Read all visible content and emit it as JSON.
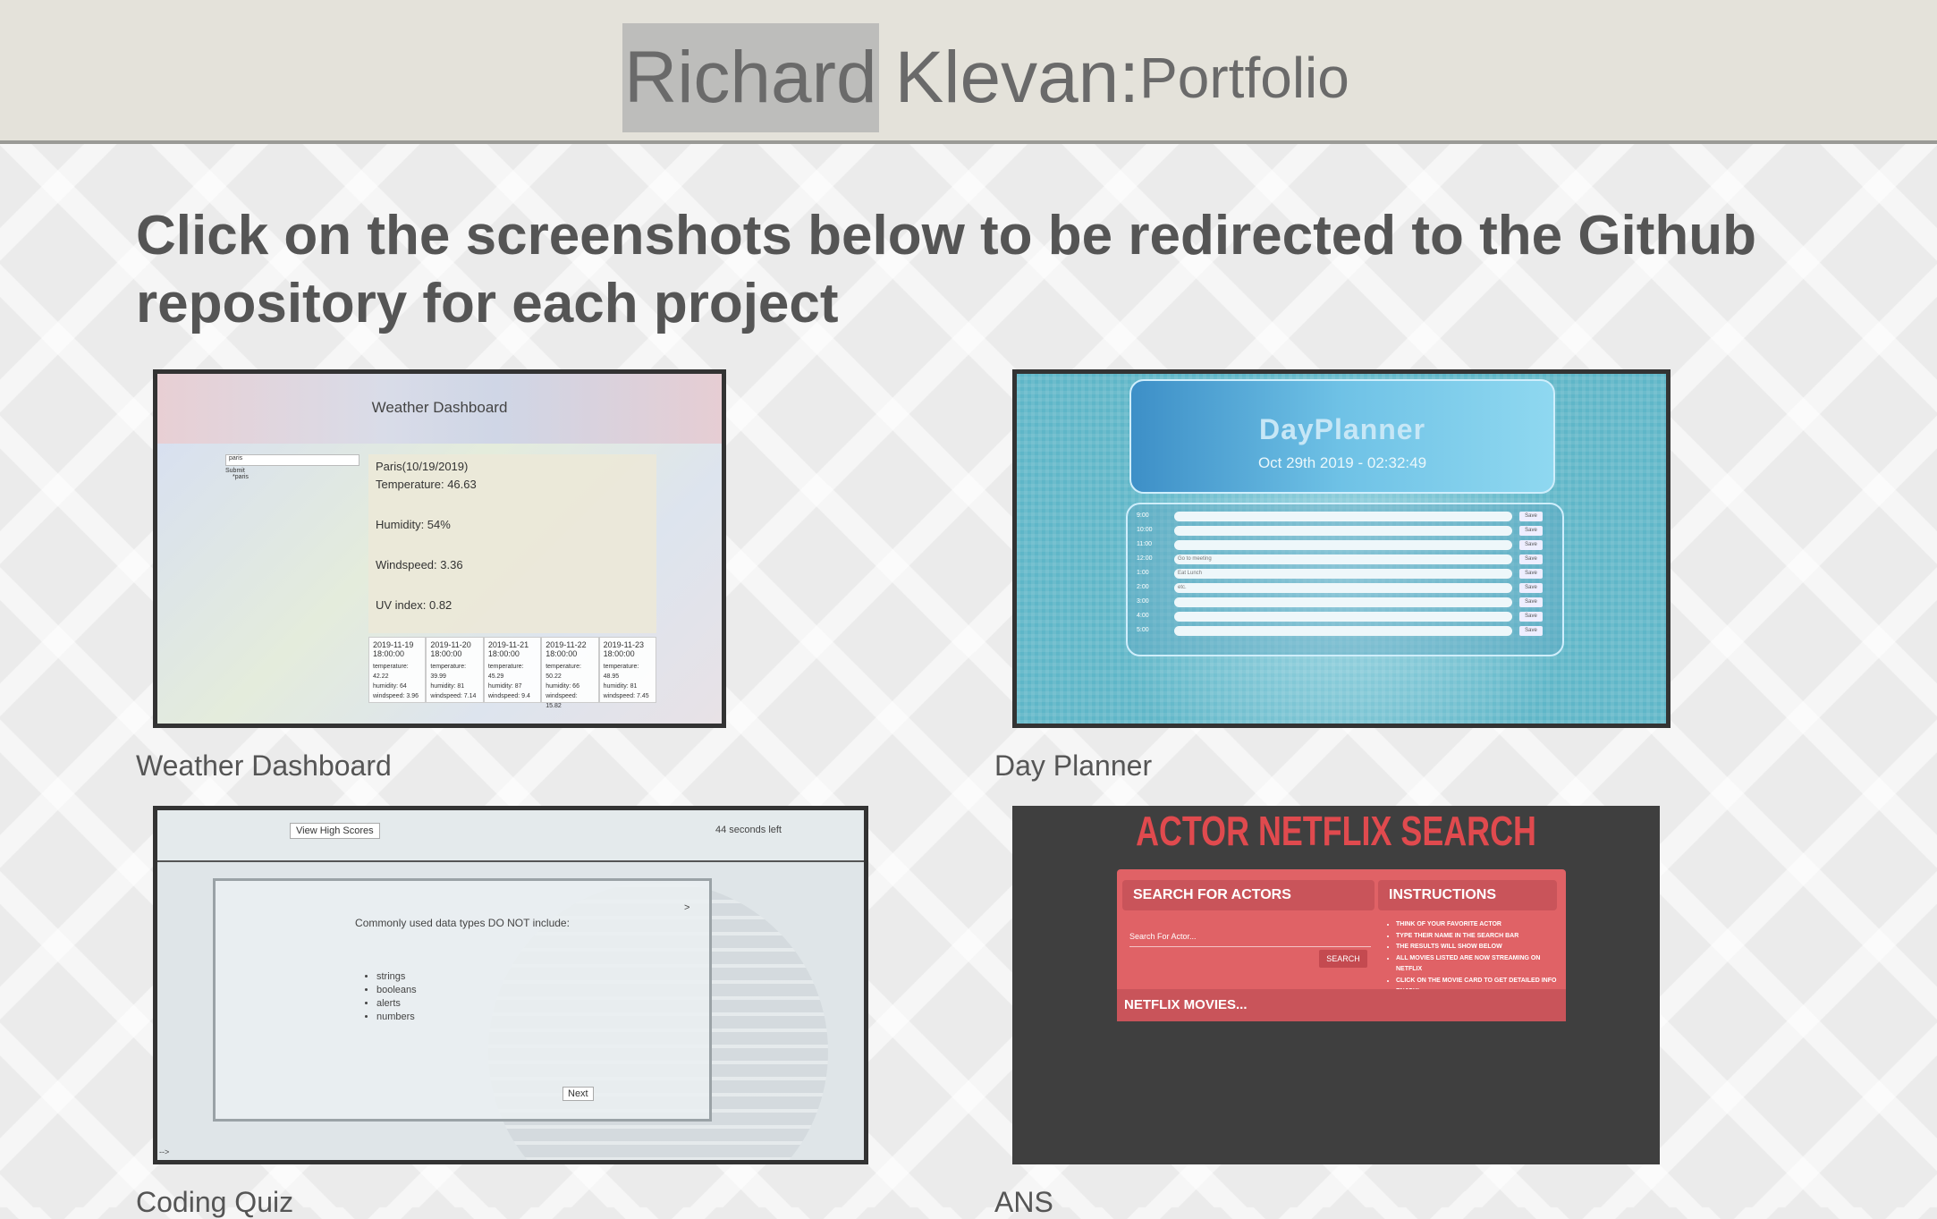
{
  "header": {
    "brand_first": "Richard",
    "brand_last": "Klevan:",
    "brand_sub": "Portfolio"
  },
  "intro": "Click on the screenshots below to be redirected to the Github repository for each project",
  "projects": [
    {
      "caption": "Weather Dashboard",
      "preview": {
        "title": "Weather Dashboard",
        "search_value": "paris",
        "submit_label": "Submit",
        "history_item": "*paris",
        "city_date": "Paris(10/19/2019)",
        "temperature": "Temperature: 46.63",
        "humidity": "Humidity: 54%",
        "windspeed": "Windspeed: 3.36",
        "uv": "UV index: 0.82",
        "forecast": [
          {
            "date": "2019-11-19 18:00:00",
            "temp": "temperature: 42.22",
            "hum": "humidity: 64",
            "wind": "windspeed: 3.96"
          },
          {
            "date": "2019-11-20 18:00:00",
            "temp": "temperature: 39.99",
            "hum": "humidity: 81",
            "wind": "windspeed: 7.14"
          },
          {
            "date": "2019-11-21 18:00:00",
            "temp": "temperature: 45.29",
            "hum": "humidity: 87",
            "wind": "windspeed: 9.4"
          },
          {
            "date": "2019-11-22 18:00:00",
            "temp": "temperature: 50.22",
            "hum": "humidity: 66",
            "wind": "windspeed: 15.82"
          },
          {
            "date": "2019-11-23 18:00:00",
            "temp": "temperature: 48.95",
            "hum": "humidity: 81",
            "wind": "windspeed: 7.45"
          }
        ]
      }
    },
    {
      "caption": "Day Planner",
      "preview": {
        "title": "DayPlanner",
        "date": "Oct 29th 2019 - 02:32:49",
        "save_label": "Save",
        "rows": [
          {
            "time": "9:00",
            "text": ""
          },
          {
            "time": "10:00",
            "text": ""
          },
          {
            "time": "11:00",
            "text": ""
          },
          {
            "time": "12:00",
            "text": "Go to meeting"
          },
          {
            "time": "1:00",
            "text": "Eat Lunch"
          },
          {
            "time": "2:00",
            "text": "etc."
          },
          {
            "time": "3:00",
            "text": ""
          },
          {
            "time": "4:00",
            "text": ""
          },
          {
            "time": "5:00",
            "text": ""
          }
        ]
      }
    },
    {
      "caption": "Coding Quiz",
      "preview": {
        "high_scores": "View High Scores",
        "timer": "44 seconds left",
        "question": "Commonly used data types DO NOT include:",
        "options": [
          "strings",
          "booleans",
          "alerts",
          "numbers"
        ],
        "next_label": "Next",
        "arrow": ">",
        "footer_arrow": "-->"
      }
    },
    {
      "caption": "ANS",
      "preview": {
        "title": "ACTOR NETFLIX SEARCH",
        "search_heading": "SEARCH FOR ACTORS",
        "instructions_heading": "INSTRUCTIONS",
        "search_placeholder": "Search For Actor...",
        "search_button": "SEARCH",
        "instructions": [
          "THINK OF YOUR FAVORITE ACTOR",
          "TYPE THEIR NAME IN THE SEARCH BAR",
          "THE RESULTS WILL SHOW BELOW",
          "ALL MOVIES LISTED ARE NOW STREAMING ON NETFLIX",
          "CLICK ON THE MOVIE CARD TO GET DETAILED INFO",
          "ENJOY!"
        ],
        "movies_heading": "NETFLIX MOVIES..."
      }
    }
  ]
}
